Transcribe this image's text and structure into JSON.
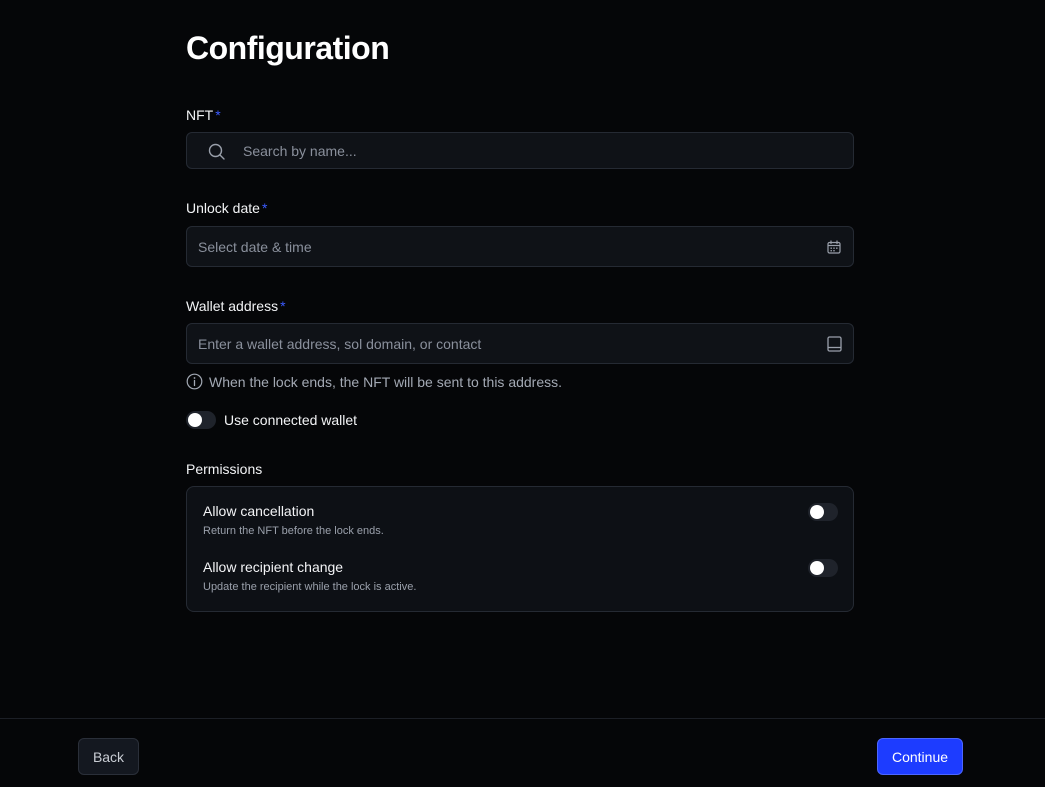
{
  "page": {
    "title": "Configuration"
  },
  "nft": {
    "label": "NFT",
    "required_mark": "*",
    "placeholder": "Search by name..."
  },
  "unlock_date": {
    "label": "Unlock date",
    "required_mark": "*",
    "placeholder": "Select date & time"
  },
  "wallet": {
    "label": "Wallet address",
    "required_mark": "*",
    "placeholder": "Enter a wallet address, sol domain, or contact",
    "hint": "When the lock ends, the NFT will be sent to this address.",
    "use_connected_label": "Use connected wallet",
    "use_connected_on": false
  },
  "permissions": {
    "heading": "Permissions",
    "items": [
      {
        "title": "Allow cancellation",
        "description": "Return the NFT before the lock ends.",
        "enabled": false
      },
      {
        "title": "Allow recipient change",
        "description": "Update the recipient while the lock is active.",
        "enabled": false
      }
    ]
  },
  "footer": {
    "back_label": "Back",
    "continue_label": "Continue"
  },
  "colors": {
    "background": "#050608",
    "accent": "#1d3cff",
    "required": "#3b5bff"
  }
}
